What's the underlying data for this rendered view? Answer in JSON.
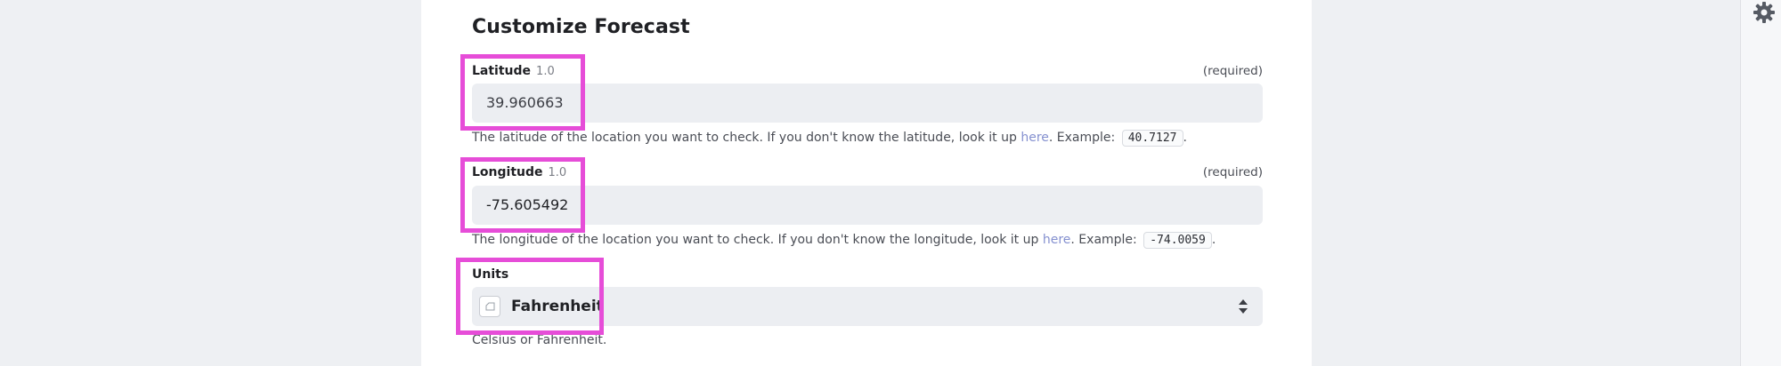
{
  "form": {
    "title": "Customize Forecast",
    "latitude": {
      "label": "Latitude",
      "version": "1.0",
      "required": "(required)",
      "value": "39.960663",
      "help_before": "The latitude of the location you want to check. If you don't know the latitude, look it up ",
      "help_link": "here",
      "help_after": ". Example:",
      "example": "40.7127",
      "help_end": "."
    },
    "longitude": {
      "label": "Longitude",
      "version": "1.0",
      "required": "(required)",
      "value": "-75.605492",
      "help_before": "The longitude of the location you want to check. If you don't know the longitude, look it up ",
      "help_link": "here",
      "help_after": ". Example:",
      "example": "-74.0059",
      "help_end": "."
    },
    "units": {
      "label": "Units",
      "value": "Fahrenheit",
      "help": "Celsius or Fahrenheit."
    }
  },
  "icons": {
    "settings": "gear-icon",
    "select_arrows": "sort-arrows-icon",
    "app": "app-icon"
  },
  "colors": {
    "highlight": "#e64dd8",
    "background": "#eef0f3",
    "input_bg": "#eceef2"
  }
}
